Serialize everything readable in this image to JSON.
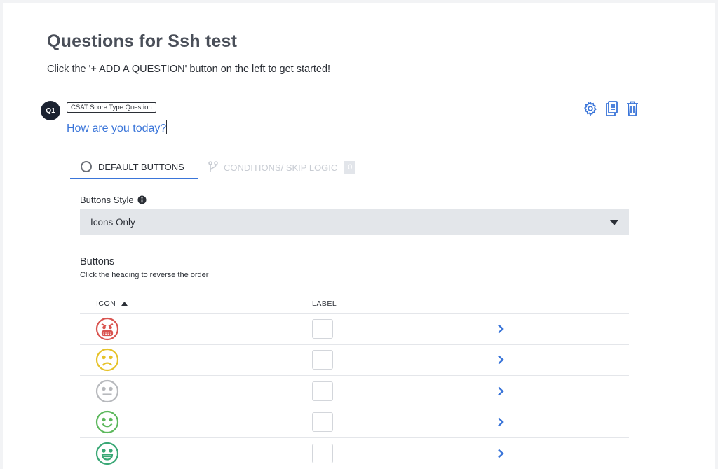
{
  "page": {
    "title": "Questions for Ssh test",
    "instructions": "Click the '+ ADD A QUESTION' button on the left to get started!"
  },
  "question": {
    "badge": "Q1",
    "type_tag": "CSAT Score Type Question",
    "title": "How are you today?",
    "action_icons": [
      "gear-icon",
      "copy-icon",
      "trash-icon"
    ]
  },
  "tabs": {
    "default_label": "DEFAULT BUTTONS",
    "conditions_label": "CONDITIONS/ SKIP LOGIC",
    "conditions_count": "0"
  },
  "buttons_style": {
    "label": "Buttons Style",
    "selected": "Icons Only"
  },
  "buttons_section": {
    "heading": "Buttons",
    "subtext": "Click the heading to reverse the order",
    "col_icon": "ICON",
    "col_label": "LABEL",
    "rows": [
      {
        "icon": "angry-face-icon",
        "color": "#d9534f",
        "label": ""
      },
      {
        "icon": "sad-face-icon",
        "color": "#e6c229",
        "label": ""
      },
      {
        "icon": "neutral-face-icon",
        "color": "#b7b9bd",
        "label": ""
      },
      {
        "icon": "smile-face-icon",
        "color": "#5cb85c",
        "label": ""
      },
      {
        "icon": "grin-face-icon",
        "color": "#3aa876",
        "label": ""
      }
    ]
  },
  "colors": {
    "accent": "#3a75d9",
    "badge_bg": "#1b2230"
  }
}
